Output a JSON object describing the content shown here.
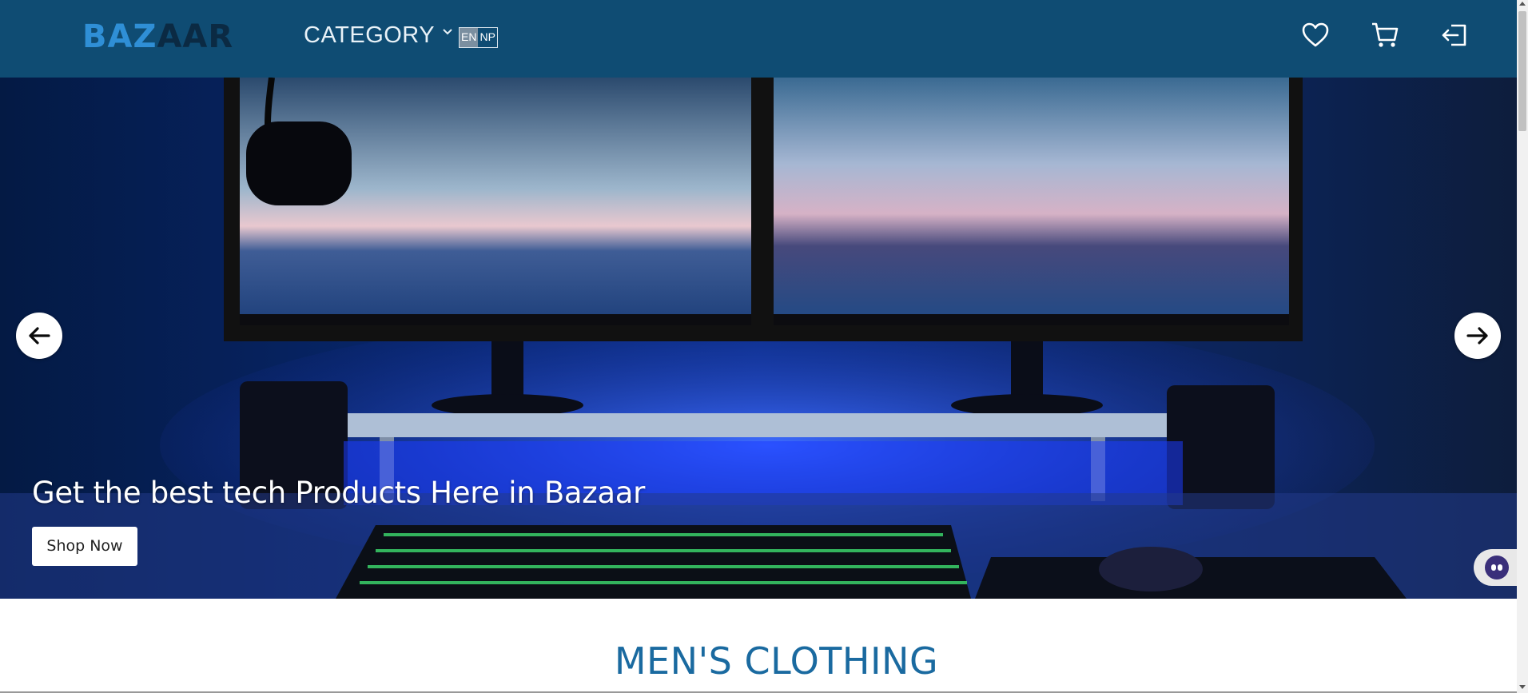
{
  "header": {
    "logo_left": "BAZ",
    "logo_right": "AAR",
    "category_label": "CATEGORY",
    "category_icon": "chevron-down-icon",
    "languages": [
      "EN",
      "NP"
    ],
    "active_language": "EN",
    "icons": [
      "heart-icon",
      "cart-icon",
      "logout-icon"
    ]
  },
  "hero": {
    "title": "Get the best tech Products Here in Bazaar",
    "cta_label": "Shop Now",
    "prev_icon": "arrow-left-icon",
    "next_icon": "arrow-right-icon",
    "chat_icon": "chatbot-icon"
  },
  "section": {
    "title": "MEN'S CLOTHING"
  },
  "colors": {
    "header_bg": "#0f4c73",
    "logo_blue": "#2f8fd6",
    "section_title": "#1a6aa0"
  }
}
